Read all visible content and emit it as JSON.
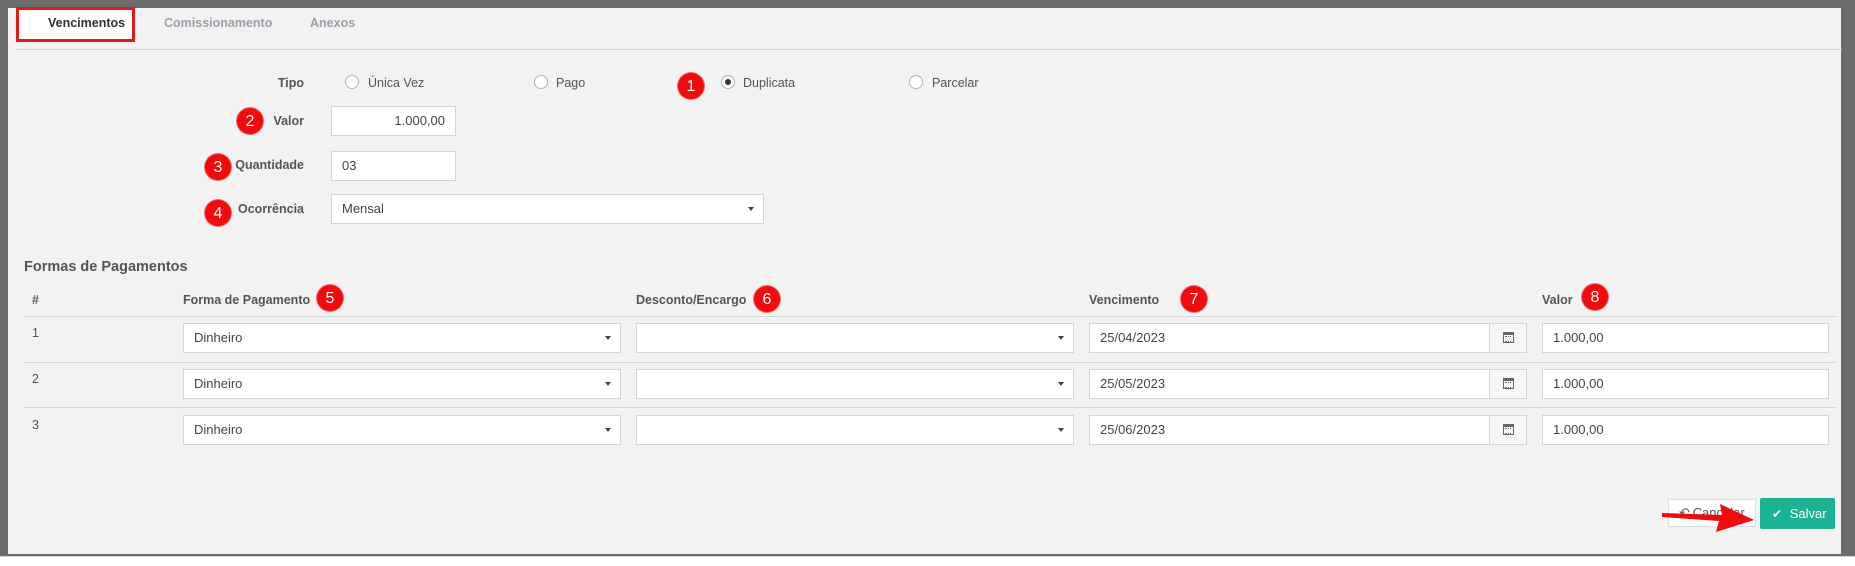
{
  "tabs": [
    {
      "label": "Vencimentos",
      "active": true
    },
    {
      "label": "Comissionamento",
      "active": false
    },
    {
      "label": "Anexos",
      "active": false
    }
  ],
  "form": {
    "tipo_label": "Tipo",
    "tipo_options": [
      "Única Vez",
      "Pago",
      "Duplicata",
      "Parcelar"
    ],
    "tipo_selected": "Duplicata",
    "valor_label": "Valor",
    "valor_value": "1.000,00",
    "quantidade_label": "Quantidade",
    "quantidade_value": "03",
    "ocorrencia_label": "Ocorrência",
    "ocorrencia_value": "Mensal"
  },
  "pagamentos": {
    "title": "Formas de Pagamentos",
    "columns": [
      "#",
      "Forma de Pagamento",
      "Desconto/Encargo",
      "Vencimento",
      "Valor"
    ],
    "rows": [
      {
        "num": "1",
        "forma": "Dinheiro",
        "desconto": "",
        "vencimento": "25/04/2023",
        "valor": "1.000,00"
      },
      {
        "num": "2",
        "forma": "Dinheiro",
        "desconto": "",
        "vencimento": "25/05/2023",
        "valor": "1.000,00"
      },
      {
        "num": "3",
        "forma": "Dinheiro",
        "desconto": "",
        "vencimento": "25/06/2023",
        "valor": "1.000,00"
      }
    ]
  },
  "badges": [
    "1",
    "2",
    "3",
    "4",
    "5",
    "6",
    "7",
    "8"
  ],
  "actions": {
    "cancel_label": "Cancelar",
    "save_label": "Salvar"
  },
  "colors": {
    "accent": "#1bb394",
    "annotation": "#ee0c0c"
  }
}
